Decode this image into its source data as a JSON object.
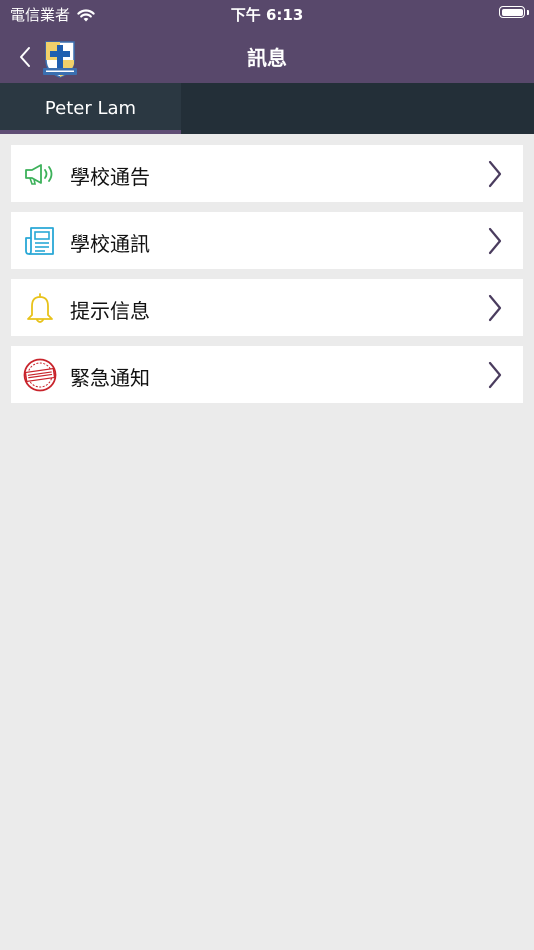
{
  "status_bar": {
    "carrier": "電信業者",
    "time": "下午 6:13"
  },
  "nav": {
    "title": "訊息"
  },
  "tabs": [
    {
      "label": "Peter Lam",
      "active": true
    }
  ],
  "menu": [
    {
      "label": "學校通告",
      "icon": "megaphone-icon",
      "color": "#3cb15a"
    },
    {
      "label": "學校通訊",
      "icon": "newsletter-icon",
      "color": "#29a8d6"
    },
    {
      "label": "提示信息",
      "icon": "bell-icon",
      "color": "#e8c21a"
    },
    {
      "label": "緊急通知",
      "icon": "urgent-stamp-icon",
      "color": "#c8232b"
    }
  ],
  "colors": {
    "nav_bg": "#58486b",
    "tab_bg": "#232f38",
    "tab_indicator": "#5f4d75",
    "page_bg": "#ebebeb",
    "chevron": "#4a3c5e"
  }
}
